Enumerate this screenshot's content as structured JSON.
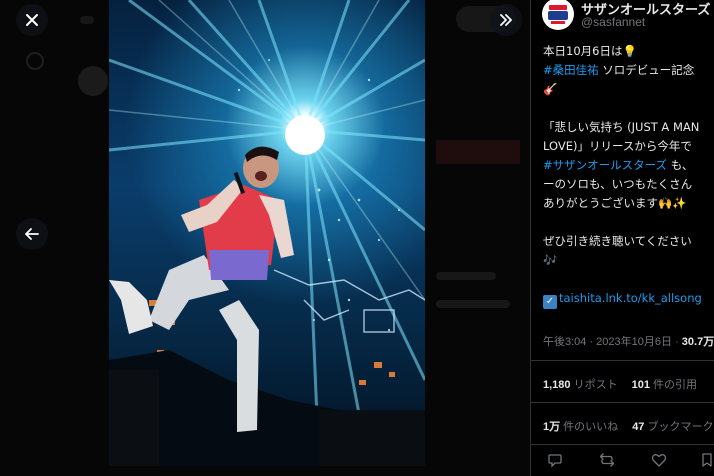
{
  "viewer": {
    "close_icon": "close-icon",
    "expand_icon": "double-chevron-right-icon",
    "prev_icon": "arrow-left-icon"
  },
  "tweet": {
    "display_name": "サザンオールスターズ of",
    "handle": "@sasfannet",
    "lines": {
      "l1": "本日10月6日は",
      "l2_tag": "#桑田佳祐",
      "l2_text": " ソロデビュー記念",
      "l4": "「悲しい気持ち (JUST A MAN",
      "l5": "LOVE)」リリースから今年で",
      "l6_tag": "#サザンオールスターズ",
      "l6_text": " も、",
      "l7": "ーのソロも、いつもたくさん",
      "l8": "ありがとうございます",
      "l10": "ぜひ引き続き聴いてください"
    },
    "link_text": "taishita.lnk.to/kk_allsong",
    "timestamp": "午後3:04 · 2023年10月6日 · ",
    "views_value": "30.7万",
    "retweets_value": "1,180",
    "retweets_label": " リポスト",
    "quotes_value": "101",
    "quotes_label": " 件の引用",
    "likes_value": "1万",
    "likes_label": " 件のいいね",
    "bookmarks_value": "47",
    "bookmarks_label": " ブックマーク"
  },
  "colors": {
    "accent": "#1d9bf0",
    "text": "#e7e9ea",
    "muted": "#71767b",
    "divider": "#2f3336"
  }
}
